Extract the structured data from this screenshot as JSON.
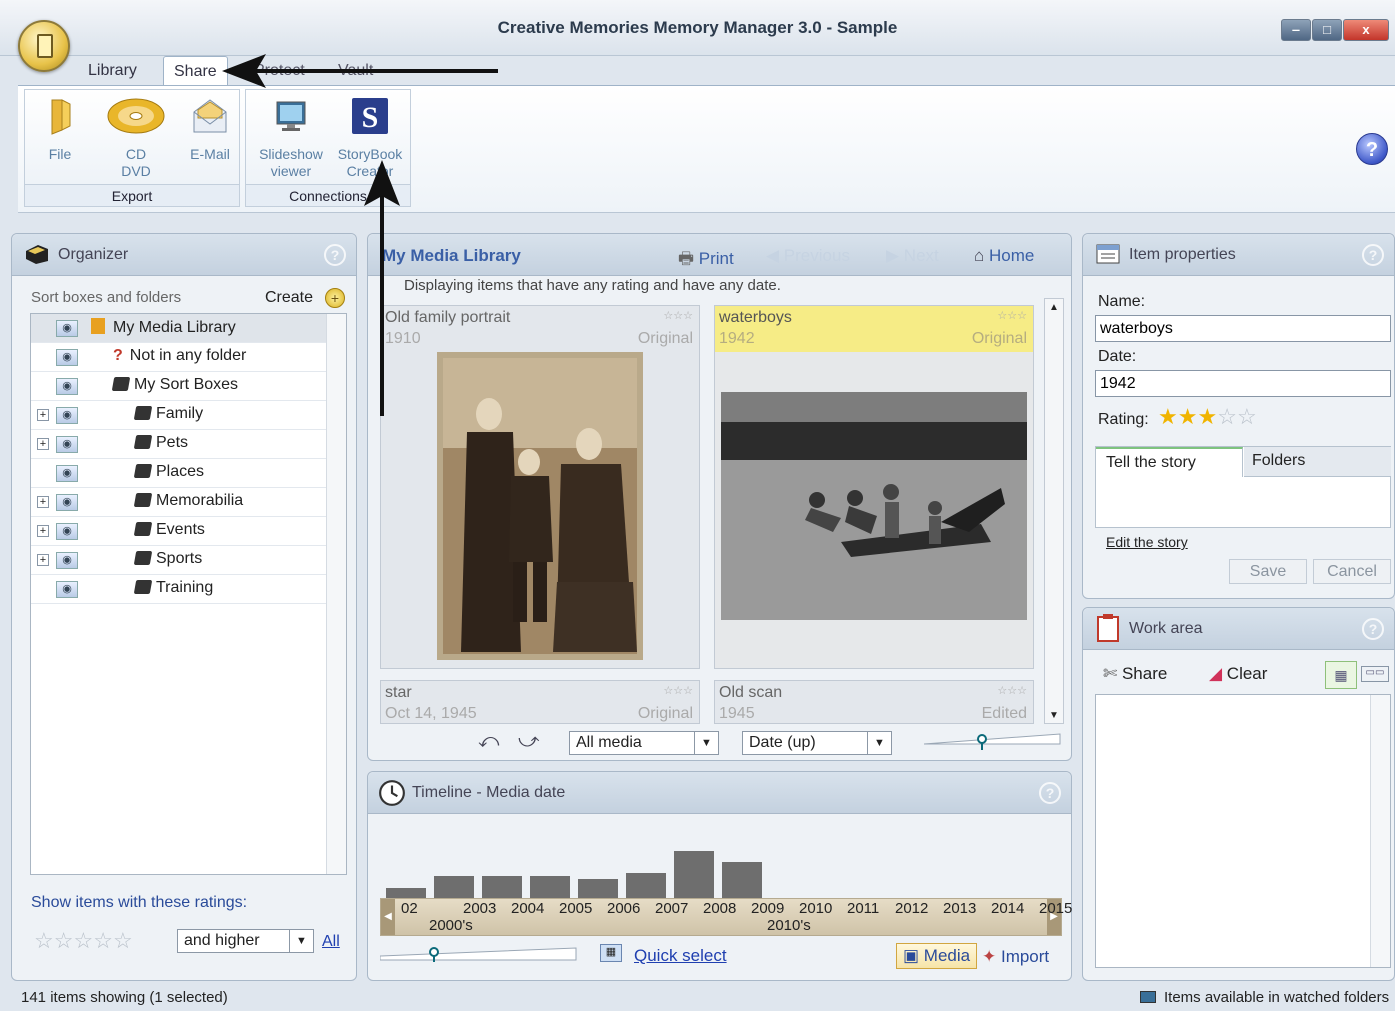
{
  "window": {
    "title": "Creative Memories Memory Manager 3.0 - Sample",
    "controls": {
      "minimize": "‒",
      "maximize": "□",
      "close": "x"
    }
  },
  "ribbon": {
    "tabs": [
      {
        "label": "Library",
        "active": false
      },
      {
        "label": "Share",
        "active": true
      },
      {
        "label": "Protect",
        "active": false
      },
      {
        "label": "Vault",
        "active": false
      }
    ],
    "groups": {
      "export": {
        "label": "Export",
        "buttons": [
          {
            "label": "File",
            "icon": "folder-icon"
          },
          {
            "label": "CD\nDVD",
            "icon": "disc-icon"
          },
          {
            "label": "E-Mail",
            "icon": "envelope-icon"
          }
        ]
      },
      "connections": {
        "label": "Connections",
        "buttons": [
          {
            "label": "Slideshow\nviewer",
            "icon": "monitor-icon"
          },
          {
            "label": "StoryBook\nCreator",
            "icon": "storybook-icon"
          }
        ]
      }
    },
    "help": "?"
  },
  "organizer": {
    "title": "Organizer",
    "help": "?",
    "sort_label": "Sort boxes and folders",
    "create_label": "Create",
    "tree": [
      {
        "label": "My Media Library",
        "expander": "",
        "indent": 0,
        "selected": true
      },
      {
        "label": "Not in any folder",
        "expander": "",
        "indent": 1
      },
      {
        "label": "My Sort Boxes",
        "expander": "",
        "indent": 1
      },
      {
        "label": "Family",
        "expander": "+",
        "indent": 2
      },
      {
        "label": "Pets",
        "expander": "+",
        "indent": 2
      },
      {
        "label": "Places",
        "expander": "",
        "indent": 2
      },
      {
        "label": "Memorabilia",
        "expander": "+",
        "indent": 2
      },
      {
        "label": "Events",
        "expander": "+",
        "indent": 2
      },
      {
        "label": "Sports",
        "expander": "+",
        "indent": 2
      },
      {
        "label": "Training",
        "expander": "",
        "indent": 2
      }
    ],
    "ratings_label": "Show items with these ratings:",
    "rating_filter": "and higher",
    "all_link": "All"
  },
  "library": {
    "title": "My Media Library",
    "print": "Print",
    "previous": "Previous",
    "next": "Next",
    "home": "Home",
    "filter_text": "Displaying items that have any rating and have any date.",
    "items": [
      {
        "name": "Old family portrait",
        "date": "1910",
        "state": "Original",
        "rating": "☆☆☆"
      },
      {
        "name": "waterboys",
        "date": "1942",
        "state": "Original",
        "rating": "☆☆☆"
      },
      {
        "name": "star",
        "date": "Oct 14, 1945",
        "state": "Original",
        "rating": "☆☆☆"
      },
      {
        "name": "Old scan",
        "date": "1945",
        "state": "Edited",
        "rating": "☆☆☆"
      }
    ],
    "media_filter": "All media",
    "sort_order": "Date (up)"
  },
  "timeline": {
    "title": "Timeline - Media date",
    "help": "?",
    "years": [
      "02",
      "2003",
      "2004",
      "2005",
      "2006",
      "2007",
      "2008",
      "2009",
      "2010",
      "2011",
      "2012",
      "2013",
      "2014",
      "2015"
    ],
    "decades": [
      "2000's",
      "2010's"
    ],
    "quick_select": "Quick select",
    "media_btn": "Media",
    "import_btn": "Import"
  },
  "item_properties": {
    "title": "Item properties",
    "help": "?",
    "name_label": "Name:",
    "name_value": "waterboys",
    "date_label": "Date:",
    "date_value": "1942",
    "rating_label": "Rating:",
    "rating_value": 3,
    "rating_max": 5,
    "tab_story": "Tell the story",
    "tab_folders": "Folders",
    "edit_story": "Edit the story",
    "save": "Save",
    "cancel": "Cancel"
  },
  "work_area": {
    "title": "Work area",
    "help": "?",
    "share": "Share",
    "clear": "Clear"
  },
  "status": {
    "left": "141 items showing  (1 selected)",
    "right": "Items available in watched folders"
  }
}
